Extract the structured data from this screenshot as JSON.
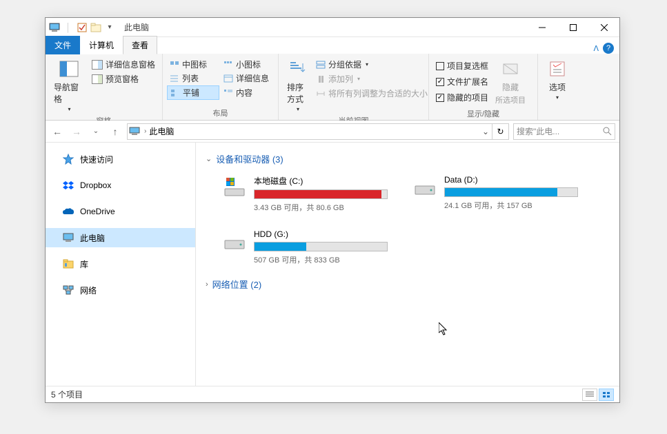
{
  "titlebar": {
    "title": "此电脑"
  },
  "tabs": {
    "file": "文件",
    "computer": "计算机",
    "view": "查看"
  },
  "ribbon": {
    "panes": {
      "nav_pane": "导航窗格",
      "preview_pane": "预览窗格",
      "detail_info": "详细信息窗格",
      "group_label": "窗格"
    },
    "layout": {
      "medium_icons": "中图标",
      "small_icons": "小图标",
      "list": "列表",
      "details": "详细信息",
      "tiles": "平铺",
      "content": "内容",
      "group_label": "布局"
    },
    "view": {
      "sort": "排序方式",
      "group_by": "分组依据",
      "add_col": "添加列",
      "autosize": "将所有列调整为合适的大小",
      "group_label": "当前视图"
    },
    "showhide": {
      "item_checkbox": "项目复选框",
      "file_ext": "文件扩展名",
      "hidden_items": "隐藏的项目",
      "hide": "隐藏",
      "hide_sub": "所选项目",
      "group_label": "显示/隐藏"
    },
    "options": {
      "label": "选项"
    }
  },
  "address": {
    "crumb": "此电脑"
  },
  "search": {
    "placeholder": "搜索\"此电..."
  },
  "sidebar": {
    "items": [
      {
        "label": "快速访问",
        "icon": "star"
      },
      {
        "label": "Dropbox",
        "icon": "dropbox"
      },
      {
        "label": "OneDrive",
        "icon": "onedrive"
      },
      {
        "label": "此电脑",
        "icon": "pc",
        "selected": true
      },
      {
        "label": "库",
        "icon": "library"
      },
      {
        "label": "网络",
        "icon": "network"
      }
    ]
  },
  "content": {
    "devices_header": "设备和驱动器 (3)",
    "network_header": "网络位置 (2)",
    "drives": [
      {
        "name": "本地磁盘 (C:)",
        "stats": "3.43 GB 可用，共 80.6 GB",
        "fill_pct": 96,
        "color": "#d9262a",
        "icon": "windrive"
      },
      {
        "name": "Data (D:)",
        "stats": "24.1 GB 可用，共 157 GB",
        "fill_pct": 85,
        "color": "#0a9ee0",
        "icon": "drive"
      },
      {
        "name": "HDD (G:)",
        "stats": "507 GB 可用，共 833 GB",
        "fill_pct": 39,
        "color": "#0a9ee0",
        "icon": "drive"
      }
    ]
  },
  "statusbar": {
    "text": "5 个项目"
  }
}
